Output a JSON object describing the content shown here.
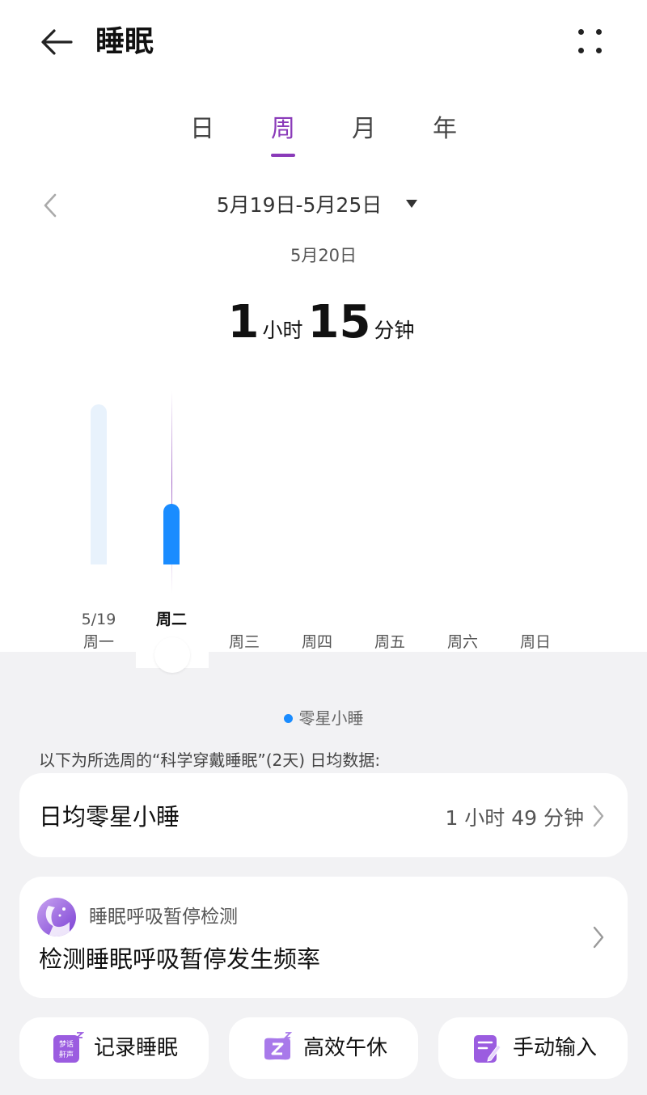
{
  "header": {
    "title": "睡眠"
  },
  "tabs": [
    {
      "label": "日",
      "active": false
    },
    {
      "label": "周",
      "active": true
    },
    {
      "label": "月",
      "active": false
    },
    {
      "label": "年",
      "active": false
    }
  ],
  "range": {
    "label": "5月19日-5月25日"
  },
  "selected": {
    "date": "5月20日",
    "hours": "1",
    "hours_unit": "小时",
    "minutes": "15",
    "minutes_unit": "分钟"
  },
  "chart_data": {
    "type": "bar",
    "categories": [
      "5/19 周一",
      "周二",
      "周三",
      "周四",
      "周五",
      "周六",
      "周日"
    ],
    "x_labels": [
      {
        "top": "5/19",
        "bottom": "周一"
      },
      {
        "top": "",
        "bottom": "周二"
      },
      {
        "top": "",
        "bottom": "周三"
      },
      {
        "top": "",
        "bottom": "周四"
      },
      {
        "top": "",
        "bottom": "周五"
      },
      {
        "top": "",
        "bottom": "周六"
      },
      {
        "top": "",
        "bottom": "周日"
      }
    ],
    "series": [
      {
        "name": "零星小睡",
        "values_minutes": [
          198,
          75,
          0,
          0,
          0,
          0,
          0
        ]
      }
    ],
    "ylim": [
      0,
      200
    ],
    "selected_index": 1,
    "colors": {
      "selected": "#1a8cff",
      "unselected": "#e8f2fc"
    }
  },
  "legend": {
    "label": "零星小睡",
    "color": "#1a8cff"
  },
  "note": "以下为所选周的“科学穿戴睡眠”(2天) 日均数据:",
  "avg_card": {
    "label": "日均零星小睡",
    "value": "1 小时 49 分钟"
  },
  "apnea_card": {
    "subtitle": "睡眠呼吸暂停检测",
    "title": "检测睡眠呼吸暂停发生频率"
  },
  "quick_actions": [
    {
      "label": "记录睡眠",
      "icon": "dream-talk-icon",
      "icon_text": [
        "梦话",
        "鼾声"
      ]
    },
    {
      "label": "高效午休",
      "icon": "nap-pillow-icon"
    },
    {
      "label": "手动输入",
      "icon": "manual-input-icon"
    }
  ],
  "accent": "#8a3ab9"
}
